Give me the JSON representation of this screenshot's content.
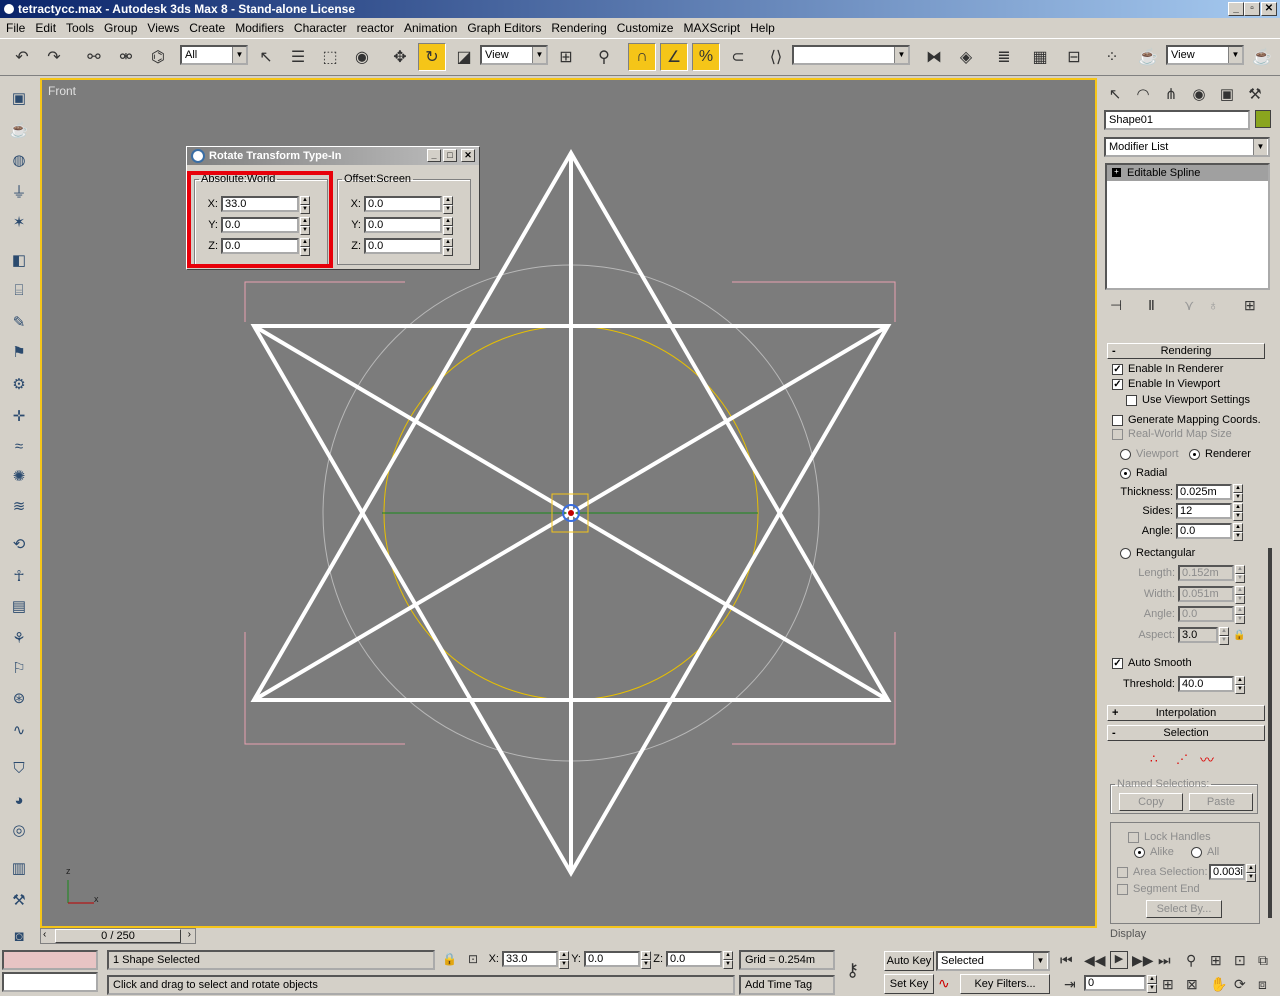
{
  "window": {
    "title": "tetractycc.max - Autodesk 3ds Max 8 - Stand-alone License",
    "min": "_",
    "max": "▫",
    "close": "✕"
  },
  "menu": [
    "File",
    "Edit",
    "Tools",
    "Group",
    "Views",
    "Create",
    "Modifiers",
    "Character",
    "reactor",
    "Animation",
    "Graph Editors",
    "Rendering",
    "Customize",
    "MAXScript",
    "Help"
  ],
  "toolbar": {
    "selection_filter": "All",
    "ref_coord": "View",
    "named_selection": "",
    "render_view": "View"
  },
  "viewport": {
    "label": "Front",
    "axis_x": "x",
    "axis_z": "z"
  },
  "dialog": {
    "title": "Rotate Transform Type-In",
    "absolute_group": "Absolute:World",
    "offset_group": "Offset:Screen",
    "absolute": [
      {
        "label": "X:",
        "value": "33.0"
      },
      {
        "label": "Y:",
        "value": "0.0"
      },
      {
        "label": "Z:",
        "value": "0.0"
      }
    ],
    "offset": [
      {
        "label": "X:",
        "value": "0.0"
      },
      {
        "label": "Y:",
        "value": "0.0"
      },
      {
        "label": "Z:",
        "value": "0.0"
      }
    ]
  },
  "command_panel": {
    "object_name": "Shape01",
    "object_color": "#8aa51e",
    "modifier_list": "Modifier List",
    "stack_item": "Editable Spline",
    "rendering": {
      "title": "Rendering",
      "enable_renderer": "Enable In Renderer",
      "enable_viewport": "Enable In Viewport",
      "use_viewport_settings": "Use Viewport Settings",
      "generate_mapping": "Generate Mapping Coords.",
      "real_world_map": "Real-World Map Size",
      "viewport": "Viewport",
      "renderer": "Renderer",
      "radial": "Radial",
      "thickness_label": "Thickness:",
      "thickness": "0.025m",
      "sides_label": "Sides:",
      "sides": "12",
      "angle_label": "Angle:",
      "angle": "0.0",
      "rectangular": "Rectangular",
      "length_label": "Length:",
      "length": "0.152m",
      "width_label": "Width:",
      "width": "0.051m",
      "angle2_label": "Angle:",
      "angle2": "0.0",
      "aspect_label": "Aspect:",
      "aspect": "3.0",
      "auto_smooth": "Auto Smooth",
      "threshold_label": "Threshold:",
      "threshold": "40.0"
    },
    "interpolation": "Interpolation",
    "selection": {
      "title": "Selection",
      "named_selections": "Named Selections:",
      "copy": "Copy",
      "paste": "Paste",
      "lock_handles": "Lock Handles",
      "alike": "Alike",
      "all": "All",
      "area_selection": "Area Selection:",
      "area_value": "0.003i",
      "segment_end": "Segment End",
      "select_by": "Select By..."
    },
    "display": "Display"
  },
  "timeline": {
    "frame": "0 / 250"
  },
  "status": {
    "selected": "1 Shape Selected",
    "prompt": "Click and drag to select and rotate objects",
    "x": "33.0",
    "y": "0.0",
    "z": "0.0",
    "x_label": "X:",
    "y_label": "Y:",
    "z_label": "Z:",
    "grid": "Grid = 0.254m",
    "add_time_tag": "Add Time Tag",
    "auto_key": "Auto Key",
    "set_key": "Set Key",
    "key_mode": "Selected",
    "key_filters": "Key Filters...",
    "current_frame": "0"
  }
}
